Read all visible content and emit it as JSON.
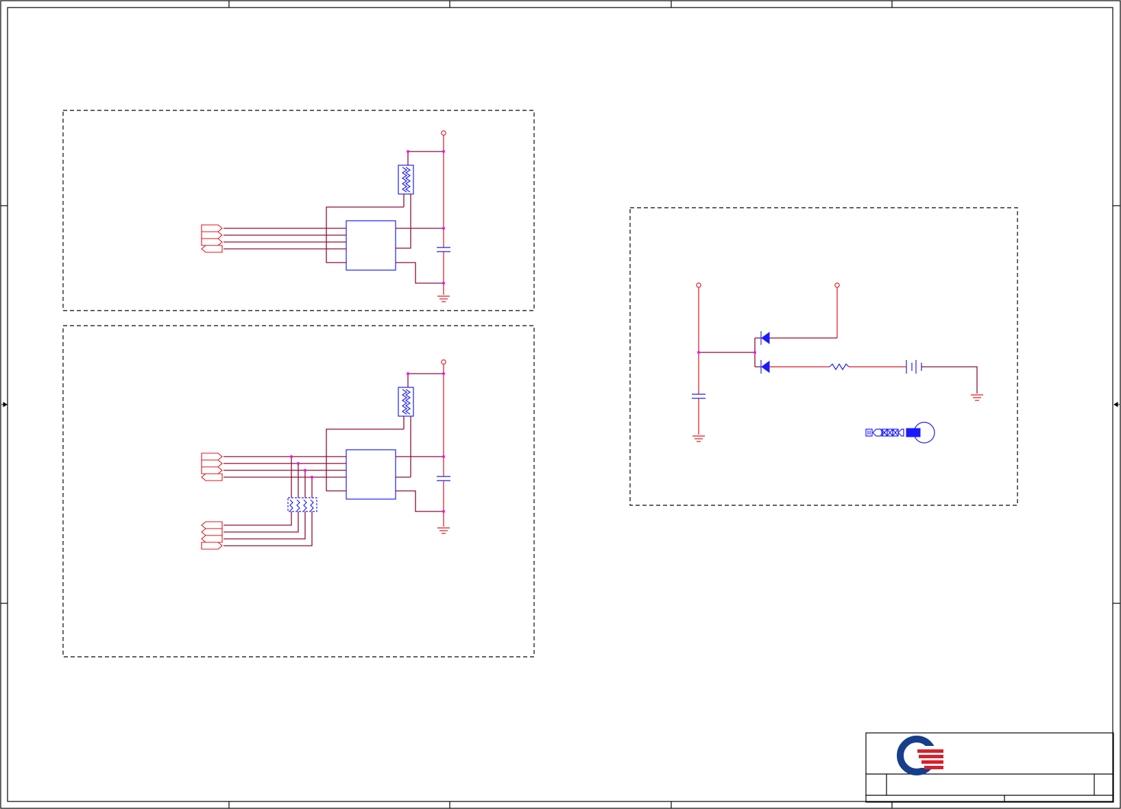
{
  "sheet": {
    "colors": {
      "wire": "#8b0a2e",
      "power": "#e0101a",
      "component": "#1a1aff",
      "junction": "#ff00ff",
      "frame": "#000000",
      "logo_blue": "#173e8c",
      "logo_red": "#d8202c"
    },
    "title_block": {
      "logo": "company-logo"
    }
  }
}
